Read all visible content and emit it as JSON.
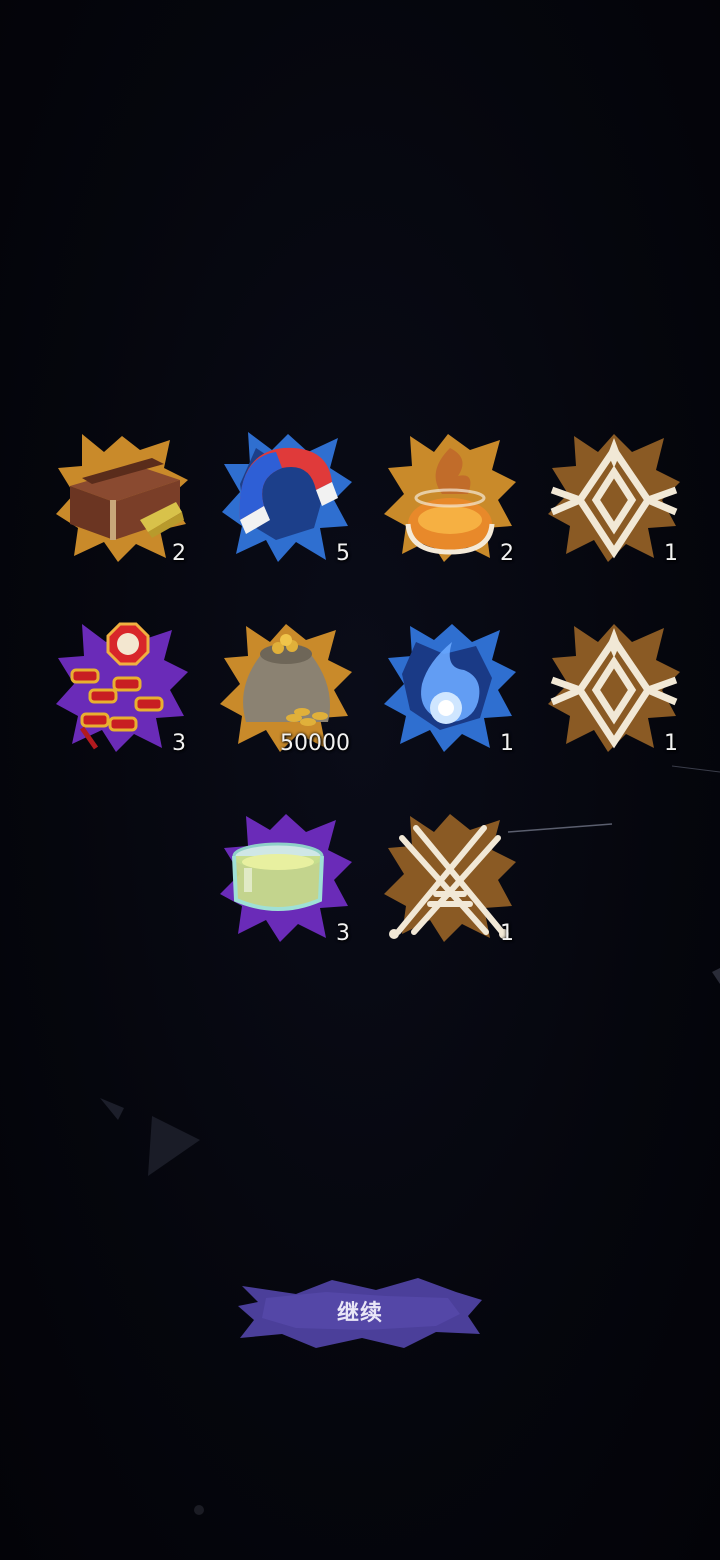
{
  "rewards": [
    {
      "item": "treasure-chest",
      "count": "2",
      "burst_color": "#c98a2a"
    },
    {
      "item": "magnet",
      "count": "5",
      "burst_color": "#2f6fd0"
    },
    {
      "item": "fire-orb-pot",
      "count": "2",
      "burst_color": "#c98a2a"
    },
    {
      "item": "rune-emblem",
      "count": "1",
      "burst_color": "#c98a2a"
    },
    {
      "item": "firecrackers",
      "count": "3",
      "burst_color": "#6a2bb8"
    },
    {
      "item": "gold-coin-sack",
      "count": "50000",
      "burst_color": "#c98a2a"
    },
    {
      "item": "blue-spirit-flame",
      "count": "1",
      "burst_color": "#2f6fd0"
    },
    {
      "item": "rune-emblem",
      "count": "1",
      "burst_color": "#c98a2a"
    },
    {
      "item": "glass-jar",
      "count": "3",
      "burst_color": "#6a2bb8"
    },
    {
      "item": "crossed-swords-emblem",
      "count": "1",
      "burst_color": "#c98a2a"
    }
  ],
  "continue_button": {
    "label": "继续",
    "color": "#4b3f9a"
  }
}
